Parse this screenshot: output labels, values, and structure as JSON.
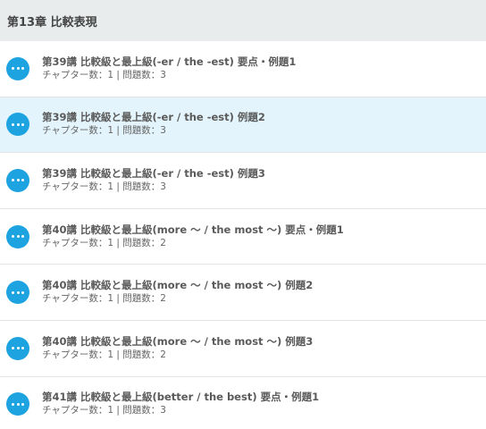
{
  "chapter": {
    "title": "第13章 比較表現"
  },
  "icon": "more-dots-icon",
  "colors": {
    "accent": "#1da3e0",
    "selected_bg": "#e3f4fc",
    "header_bg": "#e8eced"
  },
  "lessons": [
    {
      "title": "第39講 比較級と最上級(-er / the -est) 要点・例題1",
      "meta": "チャプター数：1 | 問題数：3",
      "selected": false
    },
    {
      "title": "第39講 比較級と最上級(-er / the -est) 例題2",
      "meta": "チャプター数：1 | 問題数：3",
      "selected": true
    },
    {
      "title": "第39講 比較級と最上級(-er / the -est) 例題3",
      "meta": "チャプター数：1 | 問題数：3",
      "selected": false
    },
    {
      "title": "第40講 比較級と最上級(more ～ / the most ～) 要点・例題1",
      "meta": "チャプター数：1 | 問題数：2",
      "selected": false
    },
    {
      "title": "第40講 比較級と最上級(more ～ / the most ～) 例題2",
      "meta": "チャプター数：1 | 問題数：2",
      "selected": false
    },
    {
      "title": "第40講 比較級と最上級(more ～ / the most ～) 例題3",
      "meta": "チャプター数：1 | 問題数：2",
      "selected": false
    },
    {
      "title": "第41講 比較級と最上級(better / the best) 要点・例題1",
      "meta": "チャプター数：1 | 問題数：3",
      "selected": false
    }
  ]
}
